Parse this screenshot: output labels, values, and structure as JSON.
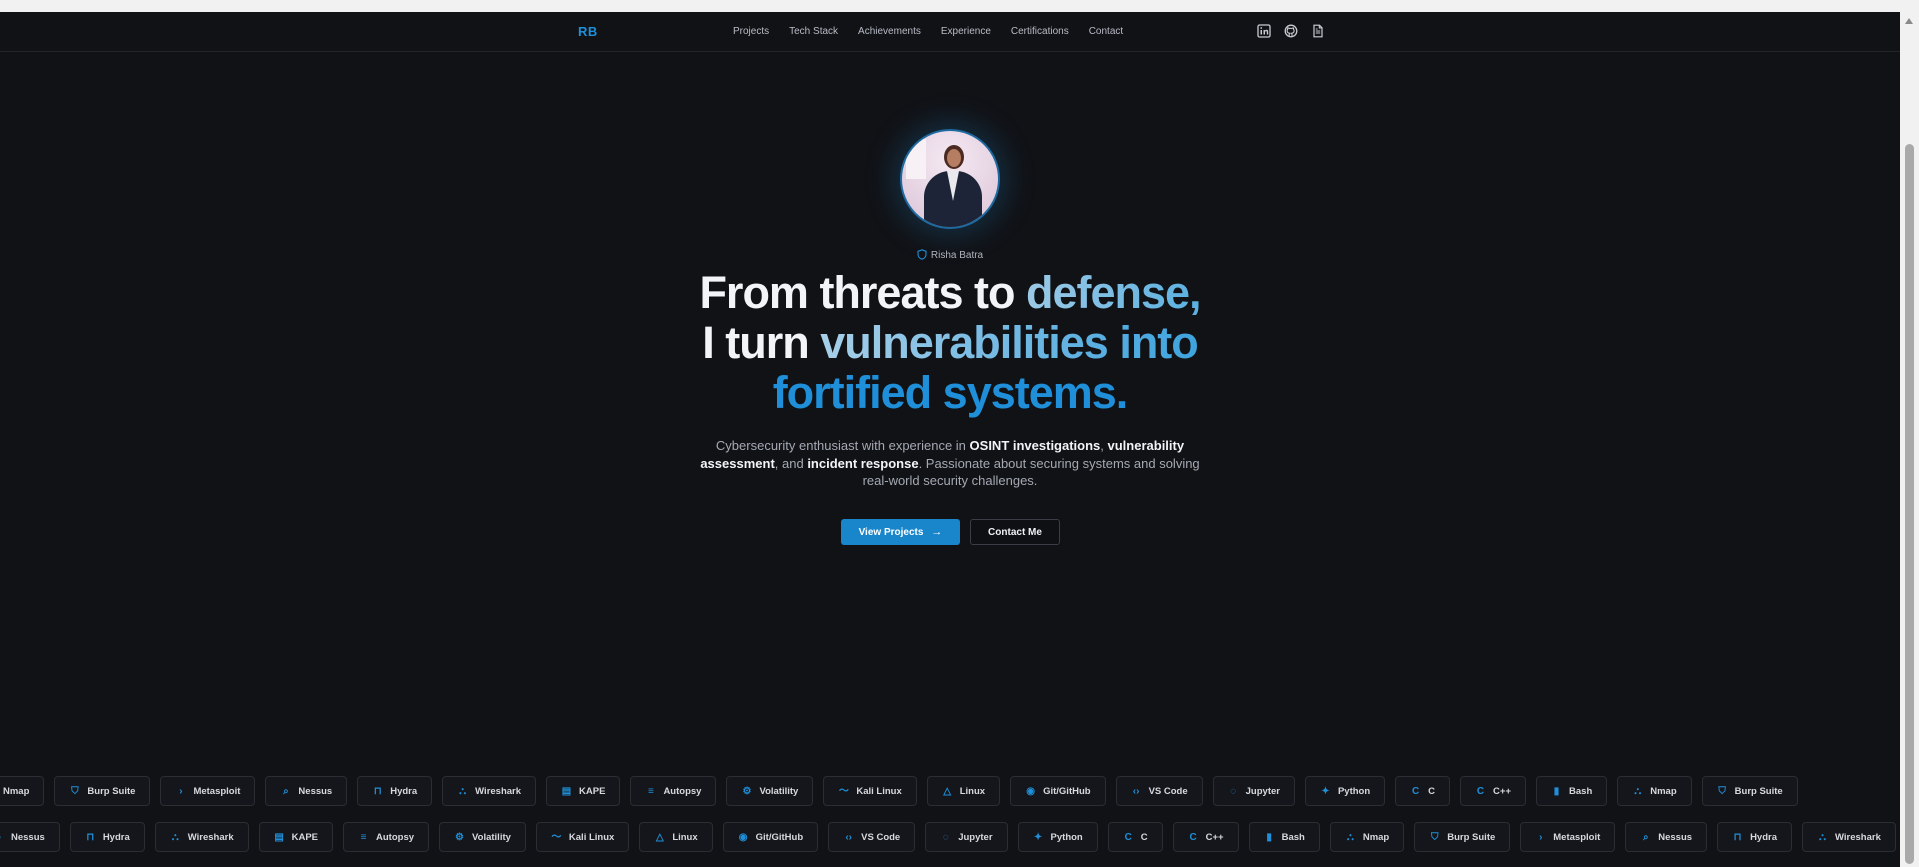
{
  "nav": {
    "logo": "RB",
    "links": [
      "Projects",
      "Tech Stack",
      "Achievements",
      "Experience",
      "Certifications",
      "Contact"
    ],
    "social_icons": [
      "linkedin-icon",
      "github-icon",
      "resume-icon"
    ]
  },
  "hero": {
    "badge_label": "Risha Batra",
    "headline": {
      "line1_white": "From threats to ",
      "line1_accent": "defense,",
      "line2_white": "I turn ",
      "line2_accent": "vulnerabilities into",
      "line3_accent": "fortified systems."
    },
    "subtext": {
      "p1": "Cybersecurity enthusiast with experience in ",
      "b1": "OSINT investigations",
      "p2": ", ",
      "b2": "vulnerability assessment",
      "p3": ", and ",
      "b3": "incident response",
      "p4": ". Passionate about securing systems and solving real-world security challenges."
    },
    "primary_button": "View Projects",
    "secondary_button": "Contact Me"
  },
  "tech_marquee": {
    "row1": [
      "Nmap",
      "Burp Suite",
      "Metasploit",
      "Nessus",
      "Hydra",
      "Wireshark",
      "KAPE",
      "Autopsy",
      "Volatility",
      "Kali Linux",
      "Linux",
      "Git/GitHub",
      "VS Code",
      "Jupyter",
      "Python",
      "C",
      "C++",
      "Bash",
      "Nmap",
      "Burp Suite"
    ],
    "row2": [
      "Nessus",
      "Hydra",
      "Wireshark",
      "KAPE",
      "Autopsy",
      "Volatility",
      "Kali Linux",
      "Linux",
      "Git/GitHub",
      "VS Code",
      "Jupyter",
      "Python",
      "C",
      "C++",
      "Bash",
      "Nmap",
      "Burp Suite",
      "Metasploit",
      "Nessus",
      "Hydra",
      "Wireshark"
    ]
  },
  "colors": {
    "background": "#111216",
    "accent": "#1e8fd8",
    "button_primary": "#1986cc"
  }
}
